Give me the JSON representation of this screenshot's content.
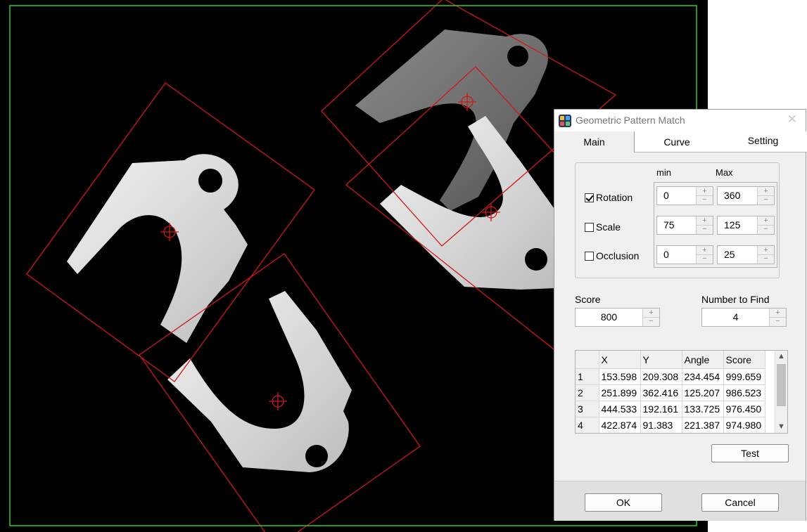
{
  "dialog": {
    "title": "Geometric Pattern Match",
    "close_glyph": "✕",
    "tabs": [
      "Main",
      "Curve",
      "Setting"
    ],
    "active_tab": "Main",
    "range_header": {
      "min": "min",
      "max": "Max"
    },
    "params": [
      {
        "label": "Rotation",
        "checked": true,
        "min": "0",
        "max": "360"
      },
      {
        "label": "Scale",
        "checked": false,
        "min": "75",
        "max": "125"
      },
      {
        "label": "Occlusion",
        "checked": false,
        "min": "0",
        "max": "25"
      }
    ],
    "score": {
      "label": "Score",
      "value": "800"
    },
    "number_to_find": {
      "label": "Number to Find",
      "value": "4"
    },
    "results": {
      "columns": [
        "",
        "X",
        "Y",
        "Angle",
        "Score"
      ],
      "rows": [
        [
          "1",
          "153.598",
          "209.308",
          "234.454",
          "999.659"
        ],
        [
          "2",
          "251.899",
          "362.416",
          "125.207",
          "986.523"
        ],
        [
          "3",
          "444.533",
          "192.161",
          "133.725",
          "976.450"
        ],
        [
          "4",
          "422.874",
          "91.383",
          "221.387",
          "974.980"
        ]
      ]
    },
    "test_label": "Test",
    "ok_label": "OK",
    "cancel_label": "Cancel",
    "spin_up_glyph": "+",
    "spin_down_glyph": "−"
  },
  "colors": {
    "roi_border": "#2ecc2e",
    "match_box": "#d01818",
    "image_background": "#000000"
  },
  "icons": {
    "app": "app-icon",
    "crosshair": "crosshair-icon"
  }
}
